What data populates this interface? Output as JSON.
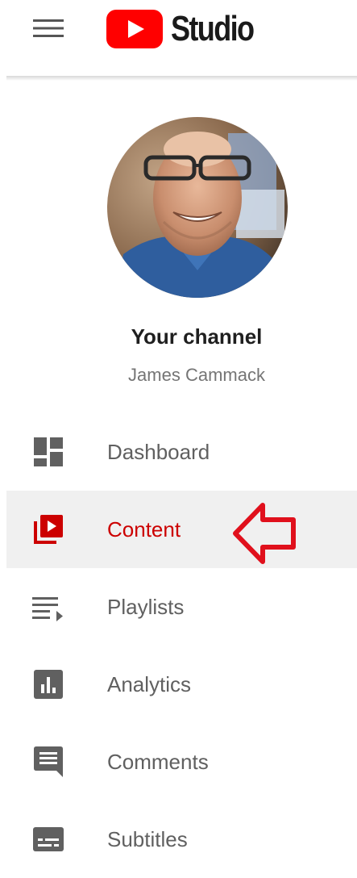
{
  "header": {
    "brand": "Studio",
    "menu_icon": "hamburger-icon",
    "logo_icon": "youtube-logo-icon",
    "brand_color": "#ff0000"
  },
  "channel": {
    "title": "Your channel",
    "owner": "James Cammack"
  },
  "nav": {
    "items": [
      {
        "label": "Dashboard",
        "icon": "dashboard-icon"
      },
      {
        "label": "Content",
        "icon": "content-icon",
        "active": true
      },
      {
        "label": "Playlists",
        "icon": "playlists-icon"
      },
      {
        "label": "Analytics",
        "icon": "analytics-icon"
      },
      {
        "label": "Comments",
        "icon": "comments-icon"
      },
      {
        "label": "Subtitles",
        "icon": "subtitles-icon"
      }
    ],
    "active_color": "#cc0000",
    "icon_color": "#606060"
  },
  "annotation": {
    "type": "red-arrow-pointing-left",
    "color": "#e0101c"
  }
}
